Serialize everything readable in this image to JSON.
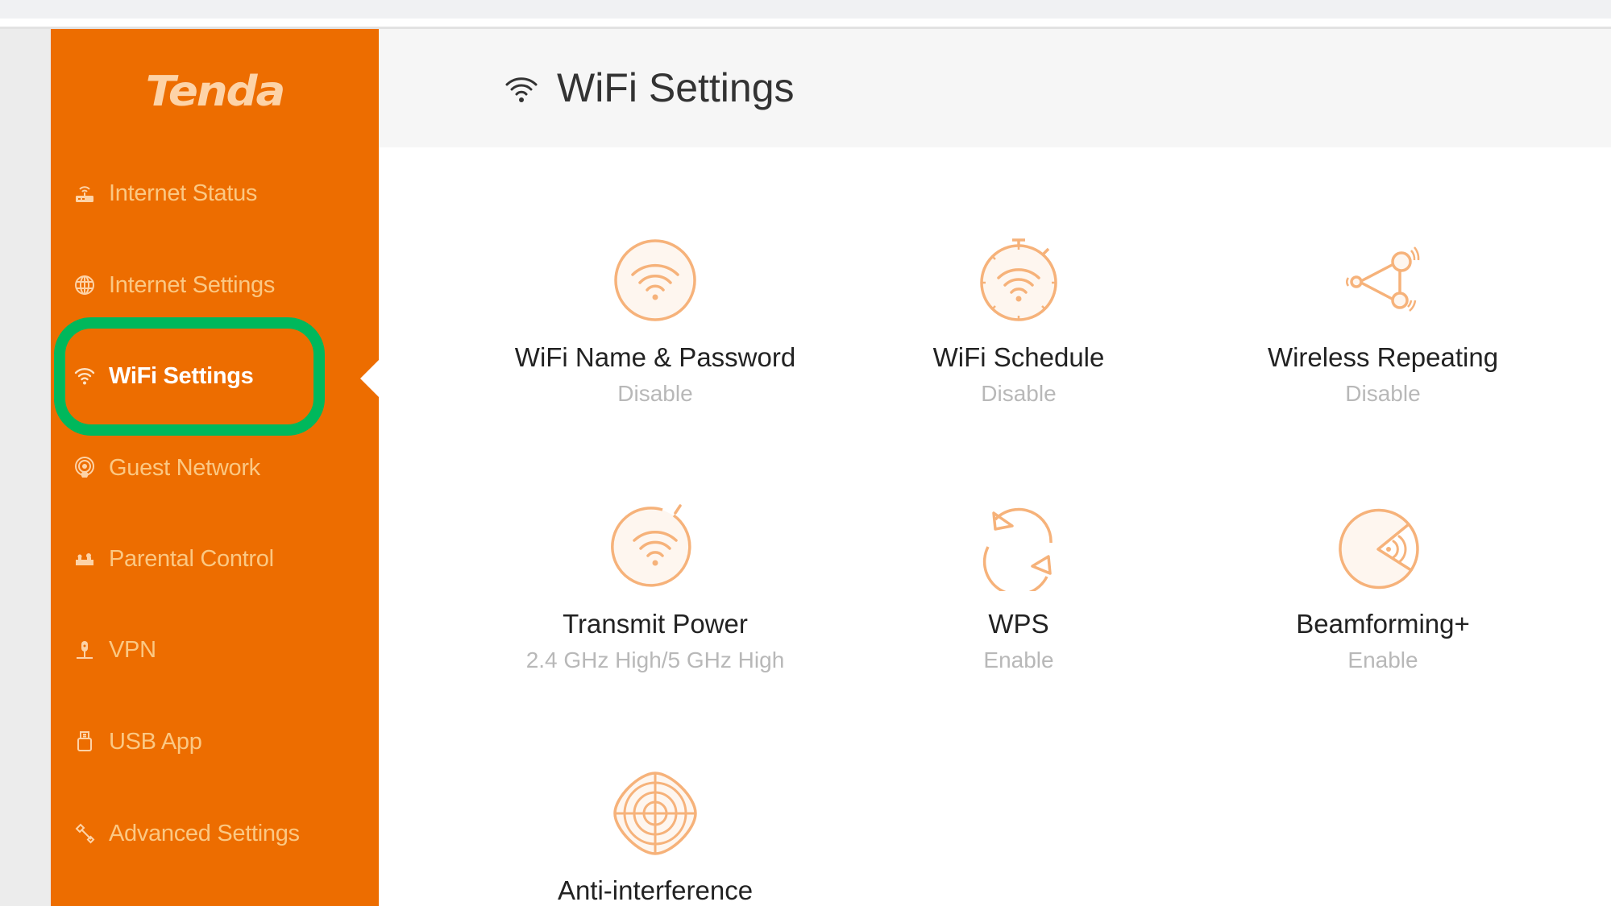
{
  "brand": {
    "logo_text": "Tenda",
    "accent_color": "#ED6D00",
    "highlight_color": "#00B85C"
  },
  "sidebar": {
    "items": [
      {
        "label": "Internet Status",
        "icon": "router-icon",
        "active": false
      },
      {
        "label": "Internet Settings",
        "icon": "globe-icon",
        "active": false
      },
      {
        "label": "WiFi Settings",
        "icon": "wifi-icon",
        "active": true
      },
      {
        "label": "Guest Network",
        "icon": "guest-network-icon",
        "active": false
      },
      {
        "label": "Parental Control",
        "icon": "parental-control-icon",
        "active": false
      },
      {
        "label": "VPN",
        "icon": "vpn-icon",
        "active": false
      },
      {
        "label": "USB App",
        "icon": "usb-icon",
        "active": false
      },
      {
        "label": "Advanced Settings",
        "icon": "wrench-icon",
        "active": false
      }
    ]
  },
  "header": {
    "title": "WiFi Settings",
    "icon": "wifi-icon"
  },
  "cards": [
    {
      "title": "WiFi Name & Password",
      "status": "Disable",
      "icon": "wifi-circle-icon"
    },
    {
      "title": "WiFi Schedule",
      "status": "Disable",
      "icon": "wifi-timer-icon"
    },
    {
      "title": "Wireless Repeating",
      "status": "Disable",
      "icon": "repeater-icon"
    },
    {
      "title": "Transmit Power",
      "status": "2.4 GHz High/5 GHz High",
      "icon": "transmit-power-icon"
    },
    {
      "title": "WPS",
      "status": "Enable",
      "icon": "wps-sync-icon"
    },
    {
      "title": "Beamforming+",
      "status": "Enable",
      "icon": "beamforming-icon"
    },
    {
      "title": "Anti-interference",
      "status": "",
      "icon": "anti-interference-icon"
    }
  ]
}
